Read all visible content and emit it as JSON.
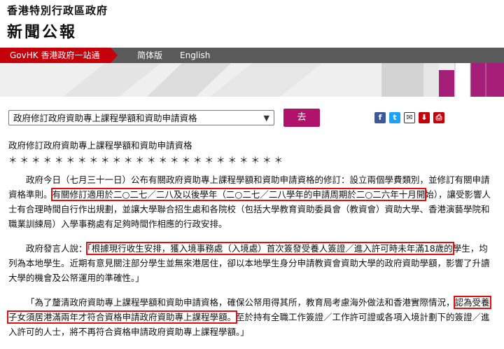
{
  "masthead": {
    "gov_name": "香港特別行政區政府",
    "press_title": "新聞公報"
  },
  "nav": {
    "gov_link": "GovHK 香港政府一站通",
    "simplified": "简体版",
    "english": "English"
  },
  "toolbar": {
    "select_value": "政府修訂政府資助專上課程學額和資助申請資格",
    "go_label": "去",
    "share_icons": [
      "facebook-icon",
      "twitter-icon",
      "email-icon",
      "save-icon",
      "print-icon"
    ]
  },
  "article": {
    "headline": "政府修訂政府資助專上課程學額和資助申請資格",
    "stars": "＊＊＊＊＊＊＊＊＊＊＊＊＊＊＊＊＊＊＊＊＊＊＊＊",
    "p1_a": "政府今日（七月三十一日）公布有關政府資助專上課程學額和資助申請資格的修訂：設立兩個學費類別，並修訂有關申請資格準則。",
    "p1_hl": "有關修訂適用於二○二七／二八及以後學年（二○二七／二八學年的申請周期於二○二六年十月開",
    "p1_b": "始），讓受影響人士有合理時間自行作出規劃，並讓大學聯合招生處和各院校（包括大學教育資助委員會（教資會）資助大學、香港演藝學院和職業訓練局）入學事務處有足夠時間作相應的行政安排。",
    "p2_a": "政府發言人說：",
    "p2_hl": "「根據現行收生安排，獲入境事務處（入境處）首次簽發受養人簽證／進入許可時未年滿18歲的",
    "p2_b": "學生，均列為本地學生。近期有意見關注部分學生並無來港居住，卻以本地學生身分申請教資會資助大學的政府資助學額，影響了升讀大學的機會及公帑運用的準確性。」",
    "p3_a": "「為了釐清政府資助專上課程學額和資助申請資格，確保公帑用得其所，教育局考慮海外做法和香港實際情況，",
    "p3_hl": "認為受養子女須居港滿兩年才符合資格申請政府資助專上課程學額。",
    "p3_b": "至於持有全職工作簽證／工作許可證或各項入境計劃下的簽證／進入許可的人士，將不再符合資格申請政府資助專上課程學額。」"
  },
  "colors": {
    "nav_red": "#c4000b",
    "nav_grey": "#5a5a5a",
    "button_magenta": "#b0146a",
    "highlight_red": "#e01010"
  }
}
